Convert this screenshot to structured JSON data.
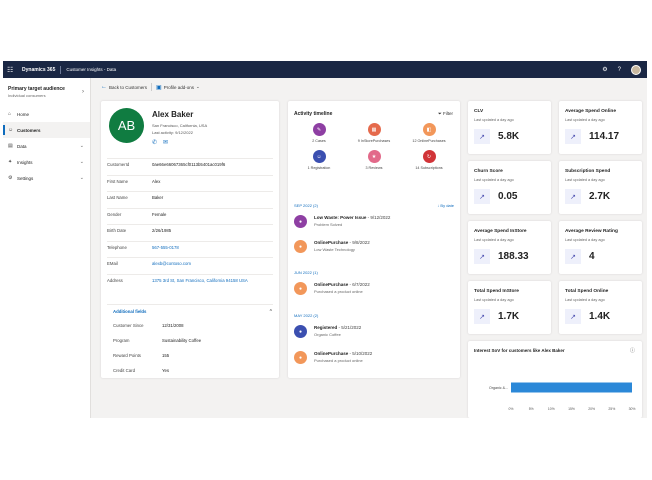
{
  "topbar": {
    "brand": "Dynamics 365",
    "app_name": "Customer Insights - Data"
  },
  "sidebar": {
    "audience_title": "Primary target audience",
    "audience_sub": "Individual consumers",
    "items": [
      {
        "label": "Home",
        "icon": "home-icon"
      },
      {
        "label": "Customers",
        "icon": "people-icon",
        "active": true
      },
      {
        "label": "Data",
        "icon": "database-icon",
        "chevron": true
      },
      {
        "label": "Insights",
        "icon": "lightbulb-icon",
        "chevron": true
      },
      {
        "label": "Settings",
        "icon": "gear-icon",
        "chevron": true
      }
    ]
  },
  "command_bar": {
    "back_label": "Back to Customers",
    "profile_addons_label": "Profile add-ons"
  },
  "profile": {
    "initials": "AB",
    "name": "Alex Baker",
    "location": "San Francisco, California, USA",
    "last_activity": "Last activity: 9/12/2022",
    "fields": [
      {
        "label": "CustomerId",
        "value": "0ae66e66067365cf0113b5401ac019f6"
      },
      {
        "label": "First Name",
        "value": "Alex"
      },
      {
        "label": "Last Name",
        "value": "Baker"
      },
      {
        "label": "Gender",
        "value": "Female"
      },
      {
        "label": "Birth Date",
        "value": "2/26/1985"
      },
      {
        "label": "Telephone",
        "value": "567-555-0178",
        "link": true
      },
      {
        "label": "EMail",
        "value": "alexb@contoso.com",
        "link": true
      },
      {
        "label": "Address",
        "value": "1375 3rd St, San Francisco, California 94158 USA",
        "link": true
      }
    ],
    "additional_fields_label": "Additional fields",
    "additional": [
      {
        "label": "Customer Since",
        "value": "12/31/2008"
      },
      {
        "label": "Program",
        "value": "Sustainability Coffee"
      },
      {
        "label": "Reward Points",
        "value": "155"
      },
      {
        "label": "Credit Card",
        "value": "Yes"
      }
    ]
  },
  "timeline": {
    "title": "Activity timeline",
    "filter_label": "Filter",
    "activity_types": [
      {
        "label": "2 Cases",
        "color": "#8e3fa3",
        "icon": "case-icon"
      },
      {
        "label": "9 InStorePurchases",
        "color": "#e56a4c",
        "icon": "store-icon"
      },
      {
        "label": "12 OnlinePurchases",
        "color": "#f2975a",
        "icon": "bag-icon"
      },
      {
        "label": "1 Registration",
        "color": "#3b4fb0",
        "icon": "person-icon"
      },
      {
        "label": "3 Reviews",
        "color": "#e26a8a",
        "icon": "star-icon"
      },
      {
        "label": "14 Subscriptions",
        "color": "#d13438",
        "icon": "refresh-icon"
      }
    ],
    "sort_label": "By date",
    "months": [
      {
        "label": "SEP 2022 (2)",
        "events": [
          {
            "title": "Low Waste: Power Issue",
            "date": "- 9/12/2022",
            "sub": "Problem Solved",
            "color": "#8e3fa3"
          },
          {
            "title": "OnlinePurchase",
            "date": "- 9/8/2022",
            "sub": "Low Waste Technology",
            "color": "#f2975a"
          }
        ]
      },
      {
        "label": "JUN 2022 (1)",
        "events": [
          {
            "title": "OnlinePurchase",
            "date": "- 6/7/2022",
            "sub": "Purchased a product online",
            "color": "#f2975a"
          }
        ]
      },
      {
        "label": "MAY 2022 (2)",
        "events": [
          {
            "title": "Registered",
            "date": "- 5/21/2022",
            "sub": "Organic Coffee",
            "color": "#3b4fb0"
          },
          {
            "title": "OnlinePurchase",
            "date": "- 5/10/2022",
            "sub": "Purchased a product online",
            "color": "#f2975a"
          }
        ]
      }
    ]
  },
  "kpis": [
    {
      "title": "CLV",
      "sub": "Last updated a day ago",
      "value": "5.8K"
    },
    {
      "title": "Average Spend Online",
      "sub": "Last updated a day ago",
      "value": "114.17"
    },
    {
      "title": "Churn Score",
      "sub": "Last updated a day ago",
      "value": "0.05"
    },
    {
      "title": "Subscription Spend",
      "sub": "Last updated a day ago",
      "value": "2.7K"
    },
    {
      "title": "Average Spend InStore",
      "sub": "Last updated a day ago",
      "value": "188.33"
    },
    {
      "title": "Average Review Rating",
      "sub": "Last updated a day ago",
      "value": "4"
    },
    {
      "title": "Total Spend InStore",
      "sub": "Last updated a day ago",
      "value": "1.7K"
    },
    {
      "title": "Total Spend Online",
      "sub": "Last updated a day ago",
      "value": "1.4K"
    }
  ],
  "chart_data": {
    "type": "bar",
    "orientation": "horizontal",
    "title": "Interest SoV for customers like Alex Baker",
    "categories": [
      "Organic &..."
    ],
    "values": [
      30
    ],
    "xlim": [
      0,
      30
    ],
    "xticks": [
      "0%",
      "5%",
      "10%",
      "15%",
      "20%",
      "25%",
      "30%"
    ],
    "bar_color": "#2b88d8",
    "grid": false
  }
}
